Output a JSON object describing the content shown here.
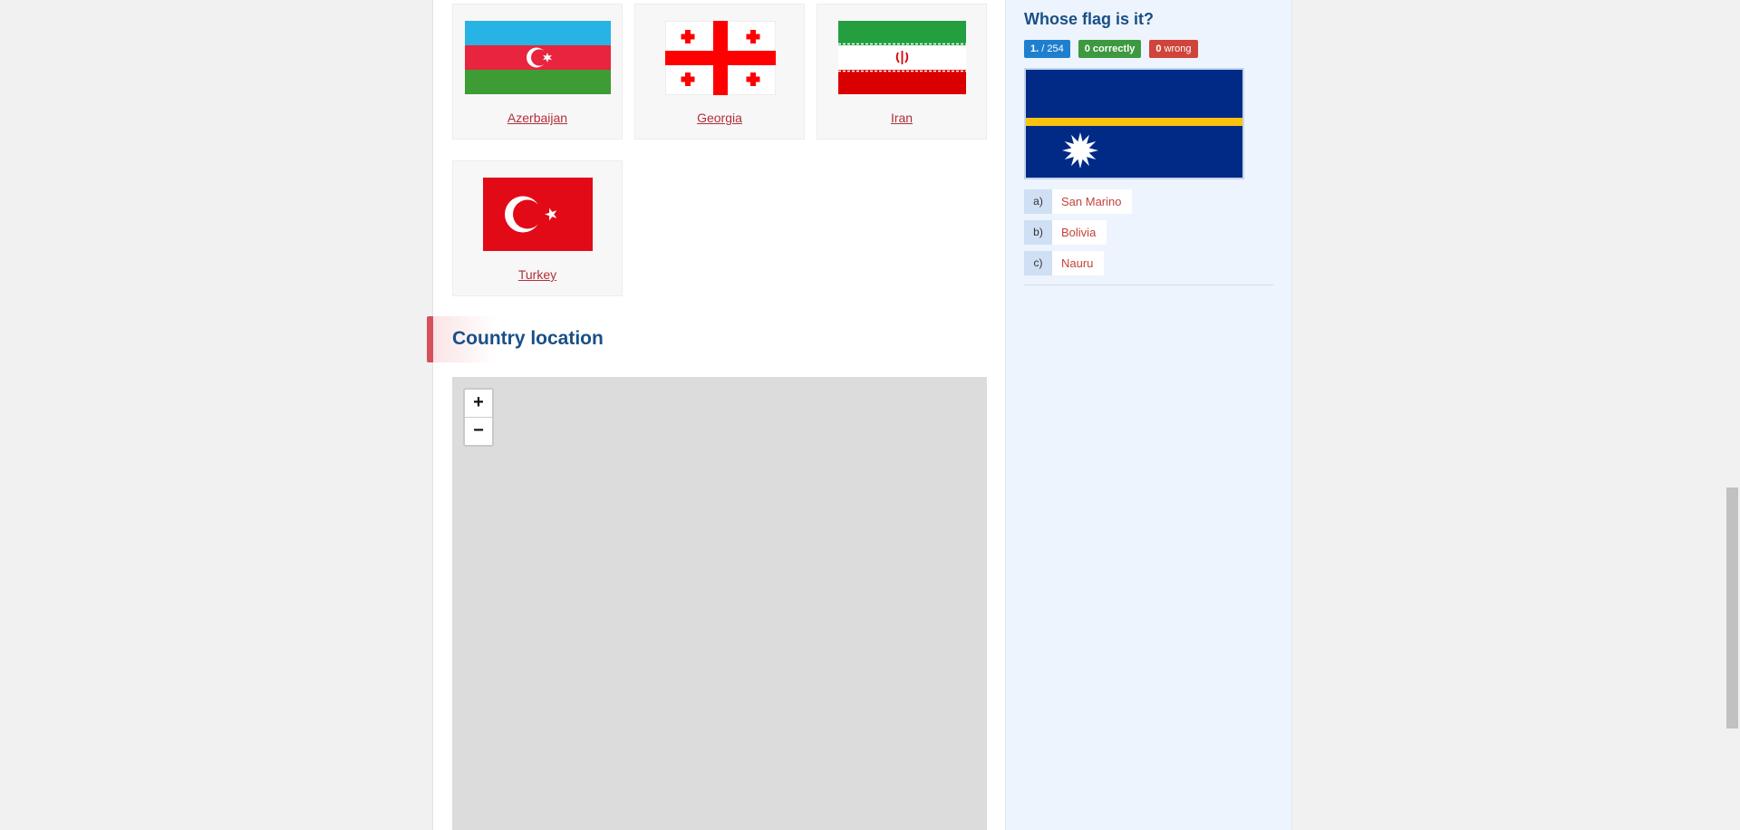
{
  "flags": [
    {
      "name": "Azerbaijan"
    },
    {
      "name": "Georgia"
    },
    {
      "name": "Iran"
    },
    {
      "name": "Turkey"
    }
  ],
  "section": {
    "title": "Country location"
  },
  "map": {
    "zoom_in": "+",
    "zoom_out": "−"
  },
  "quiz": {
    "title": "Whose flag is it?",
    "progress_current": "1.",
    "progress_total": "/ 254",
    "correct_count": "0",
    "correct_label": "correctly",
    "wrong_count": "0",
    "wrong_label": "wrong",
    "flag_depicted": "Nauru",
    "options": [
      {
        "letter": "a)",
        "answer": "San Marino"
      },
      {
        "letter": "b)",
        "answer": "Bolivia"
      },
      {
        "letter": "c)",
        "answer": "Nauru"
      }
    ]
  },
  "colors": {
    "heading": "#1a4f86",
    "link": "#b0303a",
    "badge_blue": "#1f7fcf",
    "badge_green": "#3d9940",
    "badge_red": "#d0443b",
    "sidebar_bg": "#edf4fd"
  }
}
